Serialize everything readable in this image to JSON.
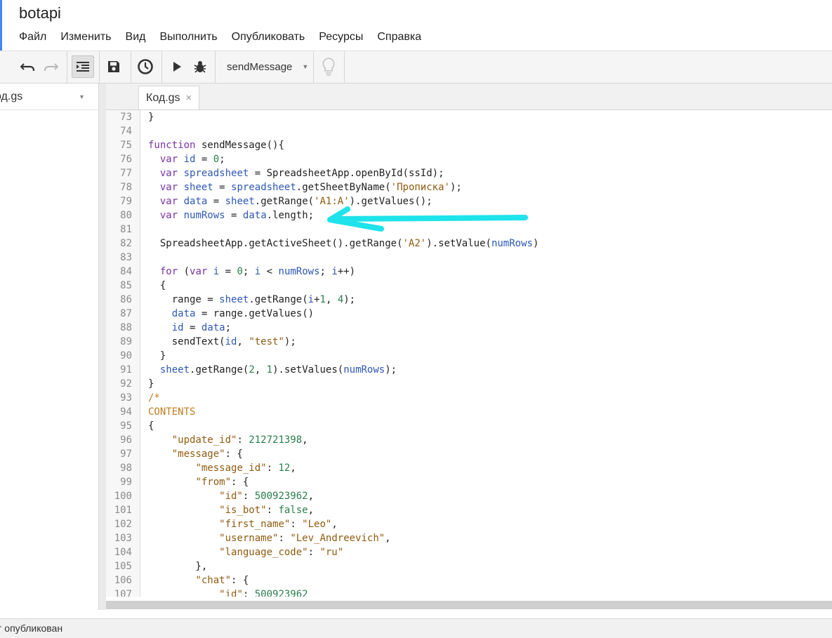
{
  "app": {
    "title": "botapi"
  },
  "menu": [
    "Файл",
    "Изменить",
    "Вид",
    "Выполнить",
    "Опубликовать",
    "Ресурсы",
    "Справка"
  ],
  "toolbar": {
    "function_name": "sendMessage",
    "icons": [
      "undo-icon",
      "redo-icon",
      "indent-icon",
      "save-icon",
      "triggers-clock-icon",
      "run-icon",
      "debug-icon",
      "lightbulb-icon"
    ]
  },
  "sidebar": {
    "file_name": "од.gs"
  },
  "editor": {
    "tab_label": "Код.gs",
    "tab_close": "×",
    "lines": [
      {
        "n": "73",
        "t": "}"
      },
      {
        "n": "74",
        "t": ""
      },
      {
        "n": "75",
        "t": "function sendMessage(){"
      },
      {
        "n": "76",
        "t": "  var id = 0;"
      },
      {
        "n": "77",
        "t": "  var spreadsheet = SpreadsheetApp.openById(ssId);"
      },
      {
        "n": "78",
        "t": "  var sheet = spreadsheet.getSheetByName('Прописка');"
      },
      {
        "n": "79",
        "t": "  var data = sheet.getRange('A1:A').getValues();"
      },
      {
        "n": "80",
        "t": "  var numRows = data.length;"
      },
      {
        "n": "81",
        "t": ""
      },
      {
        "n": "82",
        "t": "  SpreadsheetApp.getActiveSheet().getRange('A2').setValue(numRows)"
      },
      {
        "n": "83",
        "t": ""
      },
      {
        "n": "84",
        "t": "  for (var i = 0; i < numRows; i++)"
      },
      {
        "n": "85",
        "t": "  {"
      },
      {
        "n": "86",
        "t": "    range = sheet.getRange(i+1, 4);"
      },
      {
        "n": "87",
        "t": "    data = range.getValues()"
      },
      {
        "n": "88",
        "t": "    id = data;"
      },
      {
        "n": "89",
        "t": "    sendText(id, \"test\");"
      },
      {
        "n": "90",
        "t": "  }"
      },
      {
        "n": "91",
        "t": "  sheet.getRange(2, 1).setValues(numRows);"
      },
      {
        "n": "92",
        "t": "}"
      },
      {
        "n": "93",
        "t": "/*"
      },
      {
        "n": "94",
        "t": "CONTENTS"
      },
      {
        "n": "95",
        "t": "{"
      },
      {
        "n": "96",
        "t": "    \"update_id\": 212721398,"
      },
      {
        "n": "97",
        "t": "    \"message\": {"
      },
      {
        "n": "98",
        "t": "        \"message_id\": 12,"
      },
      {
        "n": "99",
        "t": "        \"from\": {"
      },
      {
        "n": "100",
        "t": "            \"id\": 500923962,"
      },
      {
        "n": "101",
        "t": "            \"is_bot\": false,"
      },
      {
        "n": "102",
        "t": "            \"first_name\": \"Leo\","
      },
      {
        "n": "103",
        "t": "            \"username\": \"Lev_Andreevich\","
      },
      {
        "n": "104",
        "t": "            \"language_code\": \"ru\""
      },
      {
        "n": "105",
        "t": "        },"
      },
      {
        "n": "106",
        "t": "        \"chat\": {"
      },
      {
        "n": "107",
        "t": "            \"id\": 500923962"
      }
    ]
  },
  "status": {
    "text": "т опубликован"
  },
  "colors": {
    "keyword": "#7a34a8",
    "variable": "#2e58b5",
    "string": "#8f5b10",
    "number": "#2a7d4c",
    "comment": "#c07c1e",
    "annotation_arrow": "#1ee3ea"
  }
}
